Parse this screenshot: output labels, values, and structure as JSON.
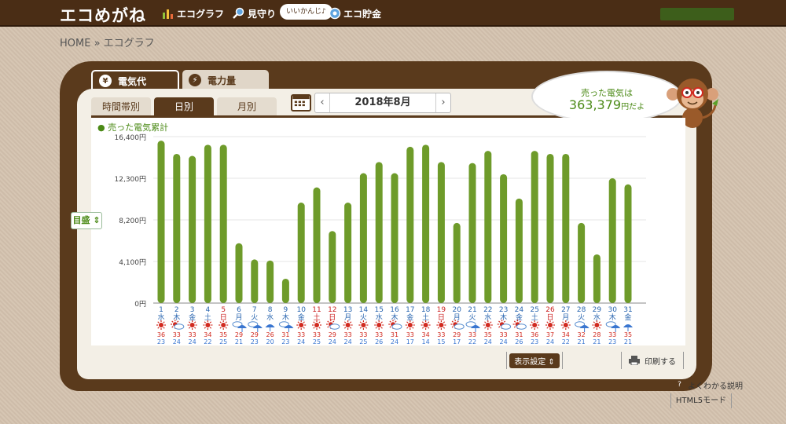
{
  "header": {
    "logo": "エコめがね",
    "nav": [
      {
        "label": "エコグラフ",
        "icon": "bar-chart-icon"
      },
      {
        "label": "見守り",
        "icon": "magnifier-icon"
      },
      {
        "label": "エコ貯金",
        "icon": "piggy-bank-icon"
      }
    ],
    "badge": "いいかんじ♪"
  },
  "breadcrumb": "HOME » エコグラフ",
  "tabs": {
    "main": [
      {
        "label": "電気代",
        "icon": "yen-icon"
      },
      {
        "label": "電力量",
        "icon": "bolt-icon"
      }
    ],
    "sub": [
      "時間帯別",
      "日別",
      "月別"
    ],
    "active_sub": "日別"
  },
  "date_nav": {
    "prev": "‹",
    "label": "2018年8月",
    "next": "›"
  },
  "bubble": {
    "line1": "売った電気は",
    "amount": "363,379",
    "unit": "円だよ"
  },
  "controls": {
    "scale_label": "目盛",
    "display_settings": "表示設定",
    "print": "印刷する",
    "help": "よくわかる説明",
    "html5": "HTML5モード"
  },
  "colors": {
    "bar": "#6e9b2a",
    "brand_brown": "#5a3a1c",
    "sun": "#d12a20",
    "rain": "#3a76d0",
    "low": "#3a76d0",
    "high": "#d12a20"
  },
  "chart_data": {
    "type": "bar",
    "title": "売った電気累計",
    "ylim": [
      0,
      16400
    ],
    "y_ticks": [
      "16,400円",
      "12,300円",
      "8,200円",
      "4,100円",
      "0円"
    ],
    "categories": [
      "1",
      "2",
      "3",
      "4",
      "5",
      "6",
      "7",
      "8",
      "9",
      "10",
      "11",
      "12",
      "13",
      "14",
      "15",
      "16",
      "17",
      "18",
      "19",
      "20",
      "21",
      "22",
      "23",
      "24",
      "25",
      "26",
      "27",
      "28",
      "29",
      "30",
      "31"
    ],
    "weekdays": [
      "水",
      "木",
      "金",
      "土",
      "日",
      "月",
      "火",
      "水",
      "木",
      "金",
      "土",
      "日",
      "月",
      "火",
      "水",
      "木",
      "金",
      "土",
      "日",
      "月",
      "火",
      "水",
      "木",
      "金",
      "土",
      "日",
      "月",
      "火",
      "水",
      "木",
      "金"
    ],
    "day_colors": [
      "#2a66b0",
      "#2a66b0",
      "#2a66b0",
      "#2a66b0",
      "#c22",
      "#2a66b0",
      "#2a66b0",
      "#2a66b0",
      "#2a66b0",
      "#2a66b0",
      "#c22",
      "#c22",
      "#2a66b0",
      "#2a66b0",
      "#2a66b0",
      "#2a66b0",
      "#2a66b0",
      "#2a66b0",
      "#c22",
      "#2a66b0",
      "#2a66b0",
      "#2a66b0",
      "#2a66b0",
      "#2a66b0",
      "#2a66b0",
      "#c22",
      "#2a66b0",
      "#2a66b0",
      "#2a66b0",
      "#2a66b0",
      "#2a66b0"
    ],
    "values": [
      16000,
      14700,
      14500,
      15600,
      15600,
      5900,
      4300,
      4200,
      2400,
      9900,
      11400,
      7100,
      9900,
      12800,
      13900,
      12800,
      15400,
      15600,
      13900,
      7900,
      13800,
      15000,
      12700,
      10300,
      15000,
      14700,
      14700,
      7900,
      4800,
      12300,
      11700
    ],
    "weather": [
      "sun",
      "sun-cloud",
      "sun",
      "sun",
      "sun",
      "cloud-rain",
      "cloud-rain",
      "rain",
      "cloud-rain",
      "sun",
      "sun",
      "sun-cloud",
      "sun",
      "sun",
      "sun",
      "sun-cloud",
      "sun",
      "sun",
      "sun",
      "sun-cloud",
      "cloud-rain",
      "sun",
      "sun-cloud",
      "sun-cloud",
      "sun",
      "sun",
      "sun",
      "cloud-rain",
      "sun",
      "cloud-rain",
      "rain"
    ],
    "temp_high": [
      "36",
      "33",
      "33",
      "34",
      "35",
      "29",
      "29",
      "26",
      "31",
      "33",
      "33",
      "29",
      "33",
      "33",
      "33",
      "31",
      "33",
      "34",
      "33",
      "29",
      "33",
      "35",
      "33",
      "31",
      "36",
      "37",
      "34",
      "32",
      "28",
      "33",
      "35"
    ],
    "temp_low": [
      "23",
      "24",
      "24",
      "22",
      "25",
      "21",
      "23",
      "20",
      "23",
      "24",
      "25",
      "24",
      "24",
      "25",
      "26",
      "24",
      "17",
      "14",
      "15",
      "17",
      "22",
      "24",
      "24",
      "26",
      "23",
      "24",
      "22",
      "21",
      "21",
      "23",
      "21"
    ]
  }
}
